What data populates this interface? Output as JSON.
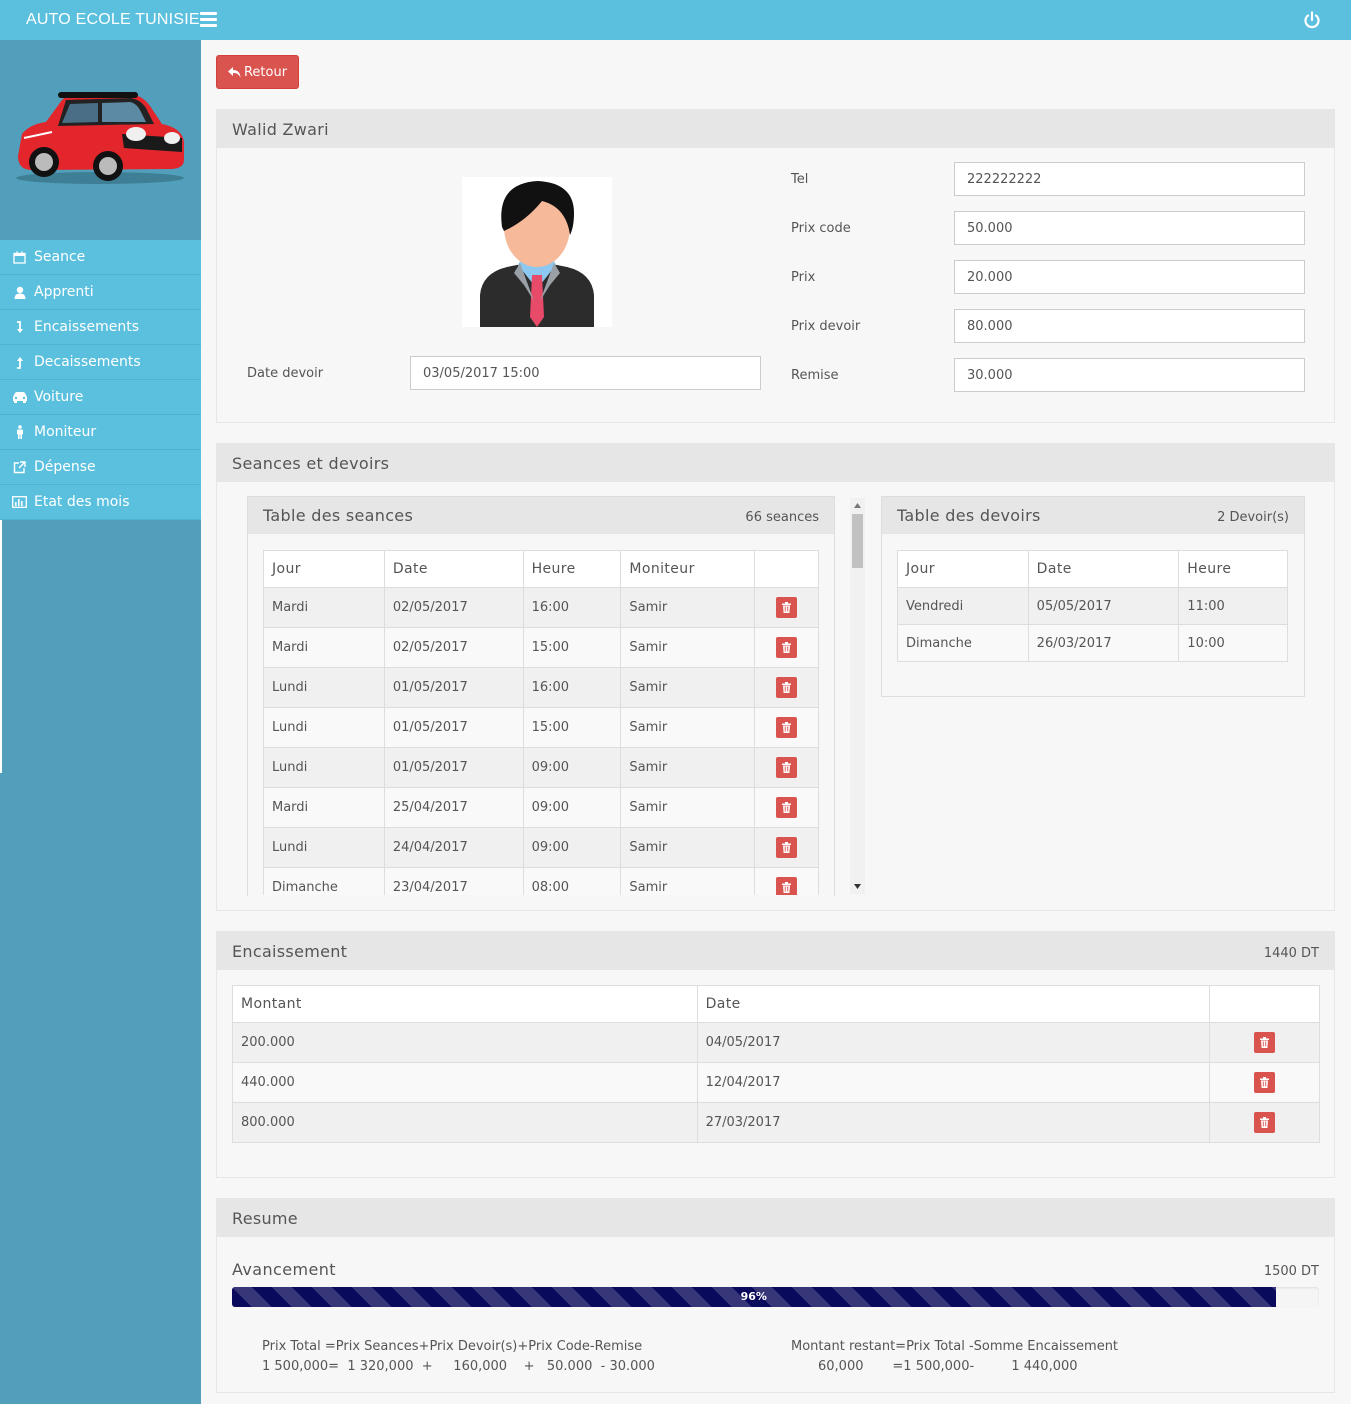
{
  "app": {
    "brand": "AUTO ECOLE TUNISIE"
  },
  "sidebar": {
    "items": [
      {
        "label": "Seance",
        "icon": "calendar-icon"
      },
      {
        "label": "Apprenti",
        "icon": "user-icon"
      },
      {
        "label": "Encaissements",
        "icon": "arrow-down-icon"
      },
      {
        "label": "Decaissements",
        "icon": "arrow-up-icon"
      },
      {
        "label": "Voiture",
        "icon": "car-icon"
      },
      {
        "label": "Moniteur",
        "icon": "male-icon"
      },
      {
        "label": "Dépense",
        "icon": "external-link-icon"
      },
      {
        "label": "Etat des mois",
        "icon": "bar-chart-icon"
      }
    ]
  },
  "actions": {
    "back_label": "Retour"
  },
  "profile": {
    "name": "Walid Zwari",
    "date_devoir_label": "Date devoir",
    "date_devoir_value": "03/05/2017 15:00",
    "fields": [
      {
        "label": "Tel",
        "value": "222222222"
      },
      {
        "label": "Prix code",
        "value": "50.000"
      },
      {
        "label": "Prix",
        "value": "20.000"
      },
      {
        "label": "Prix devoir",
        "value": "80.000"
      },
      {
        "label": "Remise",
        "value": "30.000"
      }
    ]
  },
  "sessions": {
    "title": "Seances et devoirs",
    "seances": {
      "title": "Table des seances",
      "count_label": "66 seances",
      "columns": [
        "Jour",
        "Date",
        "Heure",
        "Moniteur"
      ],
      "rows": [
        [
          "Mardi",
          "02/05/2017",
          "16:00",
          "Samir"
        ],
        [
          "Mardi",
          "02/05/2017",
          "15:00",
          "Samir"
        ],
        [
          "Lundi",
          "01/05/2017",
          "16:00",
          "Samir"
        ],
        [
          "Lundi",
          "01/05/2017",
          "15:00",
          "Samir"
        ],
        [
          "Lundi",
          "01/05/2017",
          "09:00",
          "Samir"
        ],
        [
          "Mardi",
          "25/04/2017",
          "09:00",
          "Samir"
        ],
        [
          "Lundi",
          "24/04/2017",
          "09:00",
          "Samir"
        ],
        [
          "Dimanche",
          "23/04/2017",
          "08:00",
          "Samir"
        ]
      ]
    },
    "devoirs": {
      "title": "Table des devoirs",
      "count_label": "2 Devoir(s)",
      "columns": [
        "Jour",
        "Date",
        "Heure"
      ],
      "rows": [
        [
          "Vendredi",
          "05/05/2017",
          "11:00"
        ],
        [
          "Dimanche",
          "26/03/2017",
          "10:00"
        ]
      ]
    }
  },
  "encaissement": {
    "title": "Encaissement",
    "total_label": "1440 DT",
    "columns": [
      "Montant",
      "Date"
    ],
    "rows": [
      [
        "200.000",
        "04/05/2017"
      ],
      [
        "440.000",
        "12/04/2017"
      ],
      [
        "800.000",
        "27/03/2017"
      ]
    ]
  },
  "resume": {
    "title": "Resume",
    "avancement_label": "Avancement",
    "total_label": "1500 DT",
    "progress_percent": 96,
    "progress_label": "96%",
    "formula_total_line1": "Prix Total =Prix Seances+Prix Devoir(s)+Prix Code-Remise",
    "formula_total_line2": "1 500,000=  1 320,000  +     160,000    +   50.000  - 30.000",
    "formula_rest_line1": "Montant restant=Prix Total -Somme Encaissement",
    "formula_rest_line2": "60,000       =1 500,000-         1 440,000"
  }
}
